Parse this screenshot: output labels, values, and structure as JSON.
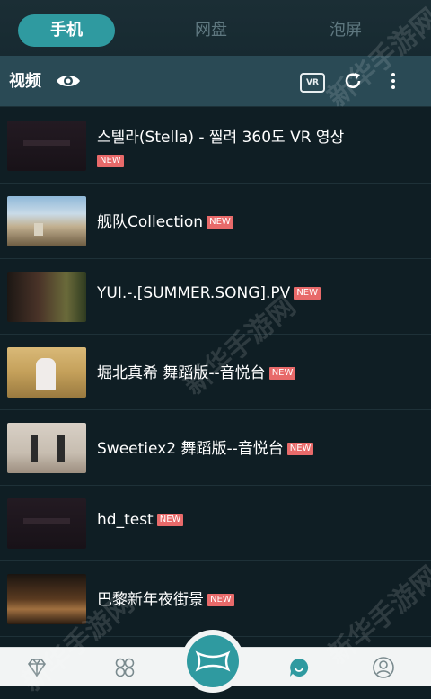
{
  "tabs": [
    {
      "label": "手机",
      "active": true
    },
    {
      "label": "网盘",
      "active": false
    },
    {
      "label": "泡屏",
      "active": false
    }
  ],
  "toolbar": {
    "title": "视频",
    "vr_label": "VR",
    "icons": [
      "eye-icon",
      "vr-icon",
      "refresh-icon",
      "more-icon"
    ]
  },
  "videos": [
    {
      "title": "스텔라(Stella) - 찔려 360도 VR 영상",
      "badge": "NEW"
    },
    {
      "title": "舰队Collection",
      "badge": "NEW"
    },
    {
      "title": "YUI.-.[SUMMER.SONG].PV",
      "badge": "NEW"
    },
    {
      "title": "堀北真希 舞蹈版--音悦台",
      "badge": "NEW"
    },
    {
      "title": "Sweetiex2 舞蹈版--音悦台",
      "badge": "NEW"
    },
    {
      "title": "hd_test",
      "badge": "NEW"
    },
    {
      "title": "巴黎新年夜街景",
      "badge": "NEW"
    }
  ],
  "bottom_nav": [
    "diamond-icon",
    "grid-icon",
    "vr-center-icon",
    "chat-icon",
    "profile-icon"
  ],
  "watermarks": [
    "新华手游网",
    "新华手游网",
    "新华手游网",
    "新华手游网"
  ],
  "colors": {
    "accent": "#2f9aa0",
    "badge": "#e86a6a",
    "background": "#0f1e24"
  }
}
